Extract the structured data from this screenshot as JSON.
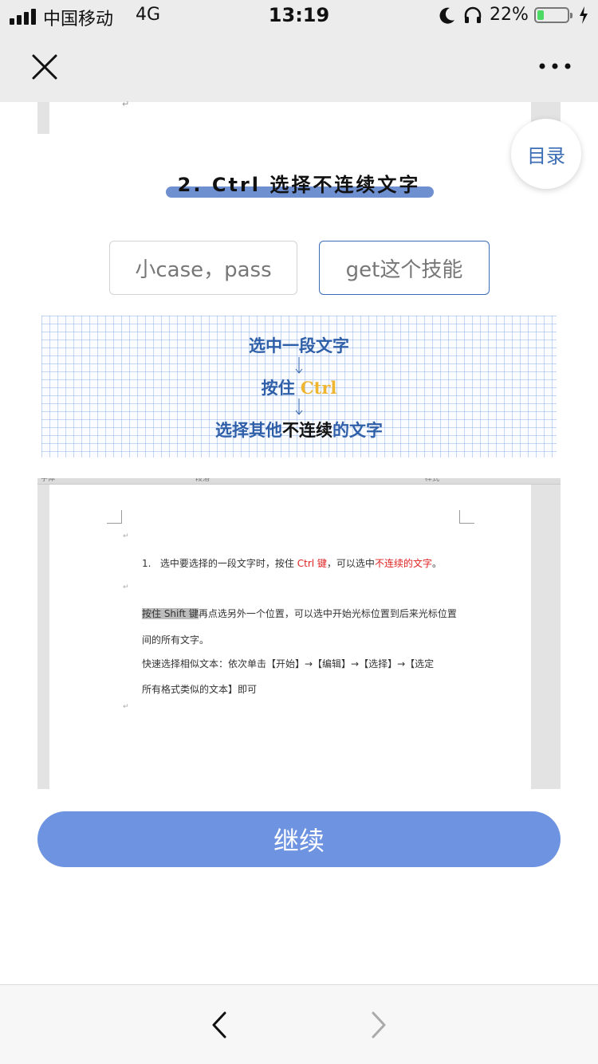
{
  "status_bar": {
    "carrier": "中国移动",
    "network": "4G",
    "time": "13:19",
    "battery_percent": "22%",
    "battery_level": 0.22,
    "icons": [
      "signal-icon",
      "moon-icon",
      "headphone-icon",
      "battery-icon",
      "charging-bolt-icon"
    ]
  },
  "nav": {
    "close_icon": "close-icon",
    "more_icon": "more-icon"
  },
  "toc_button": "目录",
  "section": {
    "title": "2. Ctrl 选择不连续文字",
    "accent_color": "#6e8fd0"
  },
  "options": {
    "skip": "小case，pass",
    "learn": "get这个技能"
  },
  "steps": {
    "step1": "选中一段文字",
    "step2_prefix": "按住 ",
    "step2_key": "Ctrl",
    "step3_a": "选择其他",
    "step3_b": "不连续",
    "step3_c": "的文字"
  },
  "doc": {
    "ribbon_labels": [
      "字体",
      "段落",
      "样式"
    ],
    "line1_num": "1.",
    "line1_text": "选中要选择的一段文字时，按住",
    "line1_key": "Ctrl 键",
    "line1_mid": "，可以选中",
    "line1_red": "不连续的文字",
    "line1_end": "。",
    "line2_hl": "按住 Shift 键",
    "line2_rest": "再点选另外一个位置，可以选中开始光标位置到后来光标位置",
    "line3": "间的所有文字。",
    "line4": "快速选择相似文本：依次单击【开始】→【编辑】→【选择】→【选定",
    "line5": "所有格式类似的文本】即可"
  },
  "continue_button": "继续",
  "bottom_nav": {
    "back_icon": "back-arrow-icon",
    "forward_icon": "forward-arrow-icon"
  },
  "colors": {
    "primary": "#6e93e0",
    "link": "#3b6db5",
    "highlight": "#f0b530"
  }
}
